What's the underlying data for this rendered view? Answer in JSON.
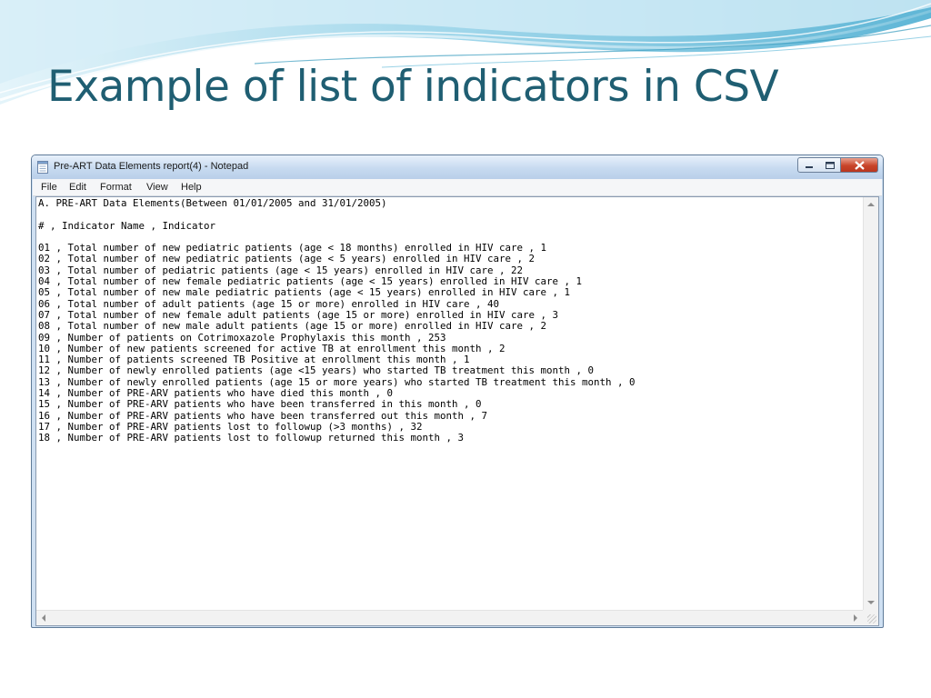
{
  "slide": {
    "title": "Example of list of indicators in CSV",
    "colors": {
      "title": "#1f5e72",
      "wave_light": "#bfe4f1",
      "wave_mid": "#7fc7e0",
      "wave_dark": "#3a9dbf"
    }
  },
  "window": {
    "title": "Pre-ART Data Elements report(4) - Notepad",
    "app_icon": "notepad-icon",
    "controls": {
      "minimize": "minimize-icon",
      "maximize": "maximize-icon",
      "close": "close-icon"
    }
  },
  "menu": {
    "items": [
      "File",
      "Edit",
      "Format",
      "View",
      "Help"
    ]
  },
  "document": {
    "lines": [
      "A. PRE-ART Data Elements(Between 01/01/2005 and 31/01/2005)",
      "",
      "# , Indicator Name , Indicator",
      "",
      "01 , Total number of new pediatric patients (age < 18 months) enrolled in HIV care , 1",
      "02 , Total number of new pediatric patients (age < 5 years) enrolled in HIV care , 2",
      "03 , Total number of pediatric patients (age < 15 years) enrolled in HIV care , 22",
      "04 , Total number of new female pediatric patients (age < 15 years) enrolled in HIV care , 1",
      "05 , Total number of new male pediatric patients (age < 15 years) enrolled in HIV care , 1",
      "06 , Total number of adult patients (age 15 or more) enrolled in HIV care , 40",
      "07 , Total number of new female adult patients (age 15 or more) enrolled in HIV care , 3",
      "08 , Total number of new male adult patients (age 15 or more) enrolled in HIV care , 2",
      "09 , Number of patients on Cotrimoxazole Prophylaxis this month , 253",
      "10 , Number of new patients screened for active TB at enrollment this month , 2",
      "11 , Number of patients screened TB Positive at enrollment this month , 1",
      "12 , Number of newly enrolled patients (age <15 years) who started TB treatment this month , 0",
      "13 , Number of newly enrolled patients (age 15 or more years) who started TB treatment this month , 0",
      "14 , Number of PRE-ARV patients who have died this month , 0",
      "15 , Number of PRE-ARV patients who have been transferred in this month , 0",
      "16 , Number of PRE-ARV patients who have been transferred out this month , 7",
      "17 , Number of PRE-ARV patients lost to followup (>3 months) , 32",
      "18 , Number of PRE-ARV patients lost to followup returned this month , 3"
    ]
  },
  "scrollbars": {
    "up": "scroll-up-arrow-icon",
    "down": "scroll-down-arrow-icon",
    "left": "scroll-left-arrow-icon",
    "right": "scroll-right-arrow-icon"
  }
}
